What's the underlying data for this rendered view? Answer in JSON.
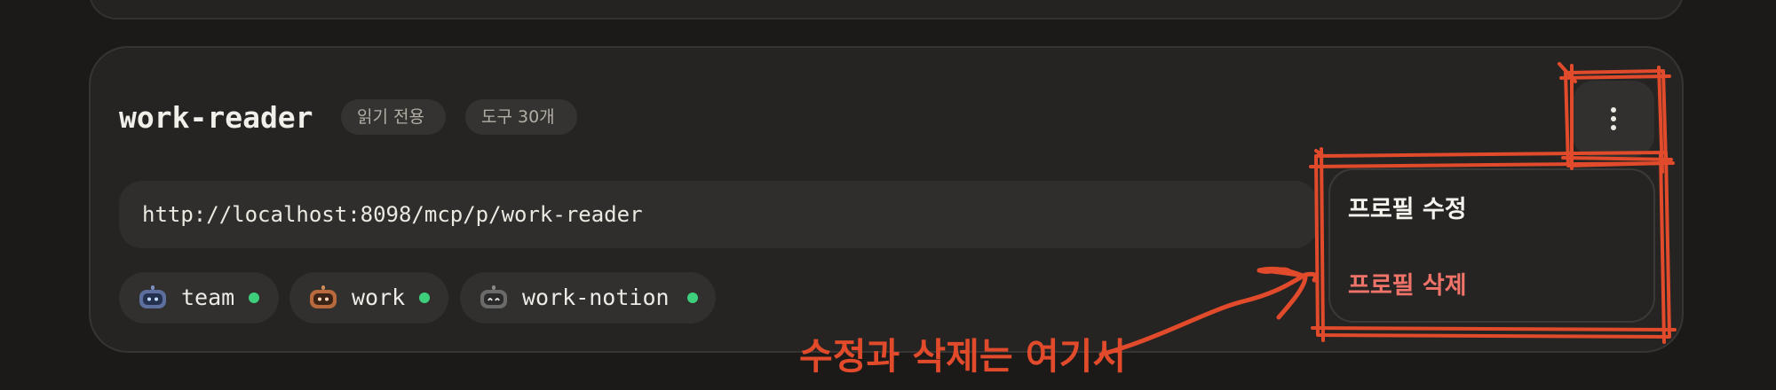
{
  "profile_card": {
    "name": "work-reader",
    "badges": {
      "readonly": "읽기 전용",
      "tools": "도구 30개"
    },
    "url": "http://localhost:8098/mcp/p/work-reader",
    "menu_button_icon": "more-vertical-icon",
    "servers": [
      {
        "label": "team",
        "icon": "robot-icon",
        "status": "active",
        "status_color": "#3ecf7c"
      },
      {
        "label": "work",
        "icon": "robot-icon",
        "status": "active",
        "status_color": "#3ecf7c"
      },
      {
        "label": "work-notion",
        "icon": "robot-icon",
        "status": "active",
        "status_color": "#3ecf7c"
      }
    ]
  },
  "dropdown_menu": {
    "items": [
      {
        "label": "프로필 수정",
        "color": "#f5f3ee"
      },
      {
        "label": "프로필 삭제",
        "color": "#f0736a"
      }
    ]
  },
  "annotation": {
    "text": "수정과 삭제는 여기서",
    "color": "#e14a2a"
  },
  "colors": {
    "background": "#1b1a19",
    "card": "#252423",
    "success": "#3ecf7c",
    "danger": "#f0736a",
    "annotation": "#e14a2a"
  }
}
